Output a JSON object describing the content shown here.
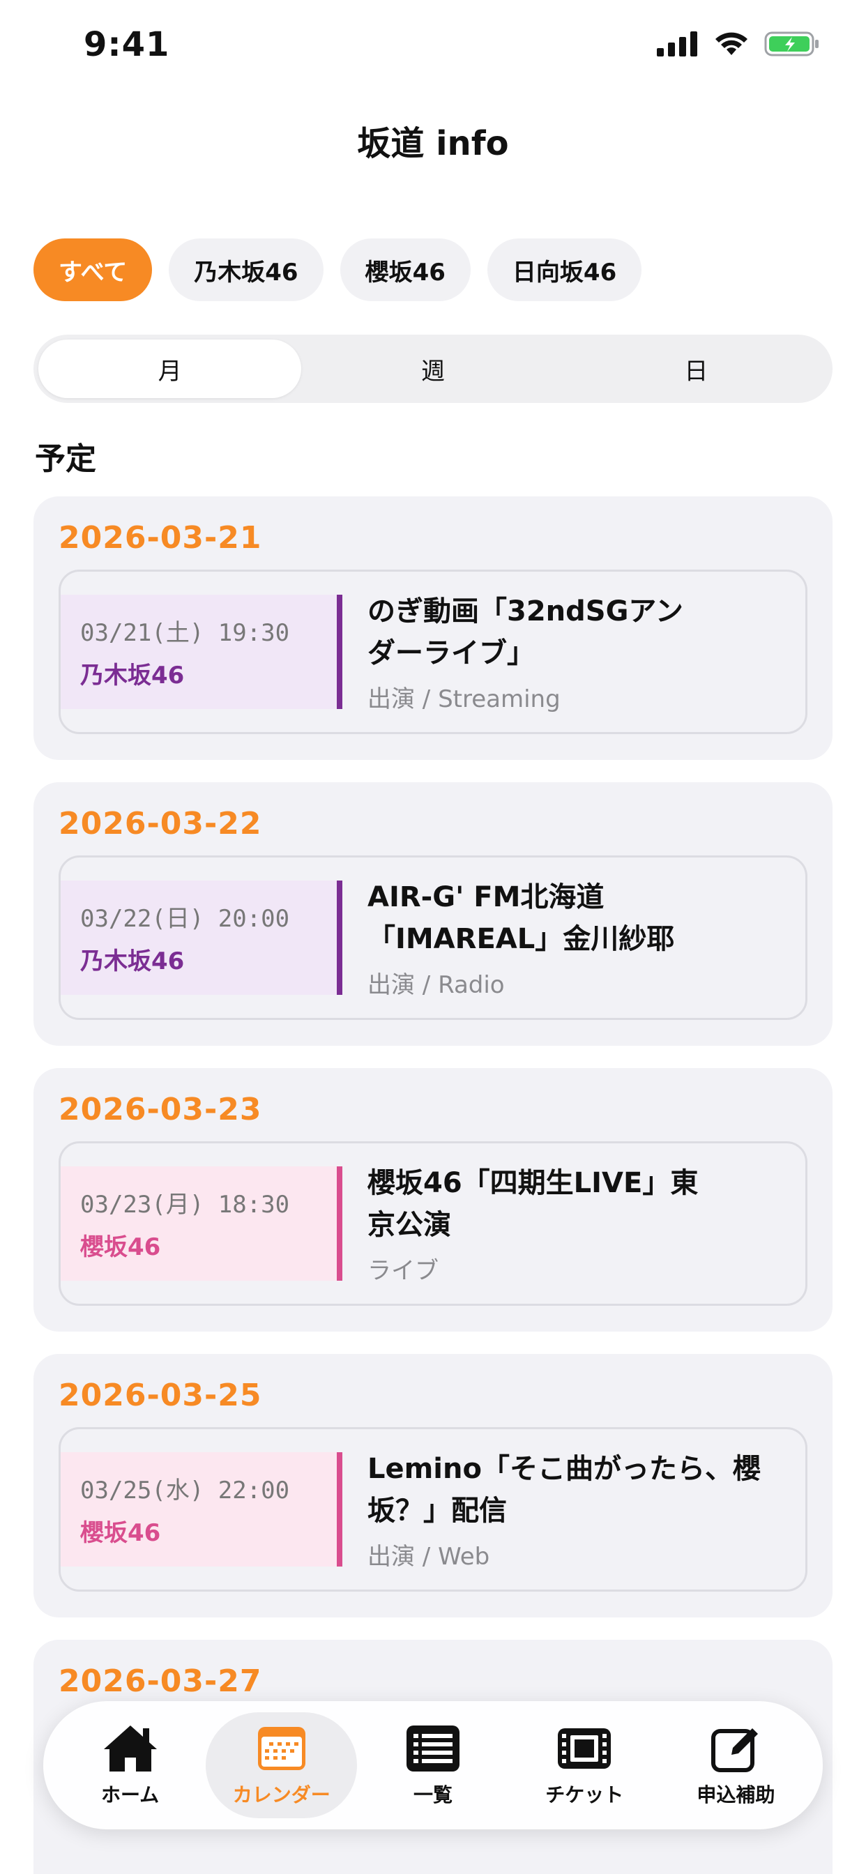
{
  "status": {
    "time": "9:41"
  },
  "title": "坂道 info",
  "filters": [
    {
      "label": "すべて",
      "active": true
    },
    {
      "label": "乃木坂46",
      "active": false
    },
    {
      "label": "櫻坂46",
      "active": false
    },
    {
      "label": "日向坂46",
      "active": false
    }
  ],
  "views": [
    {
      "label": "月",
      "active": true
    },
    {
      "label": "週",
      "active": false
    },
    {
      "label": "日",
      "active": false
    }
  ],
  "section": {
    "heading": "予定"
  },
  "days": [
    {
      "date": "2026-03-21",
      "event": {
        "time": "03/21(土) 19:30",
        "group": "乃木坂46",
        "title_line1": "のぎ動画「32ndSGアン",
        "title_line2": "ダーライブ」",
        "meta": "出演 / Streaming"
      }
    },
    {
      "date": "2026-03-22",
      "event": {
        "time": "03/22(日) 20:00",
        "group": "乃木坂46",
        "title_line1": "AIR-G' FM北海道",
        "title_line2": "「IMAREAL」金川紗耶",
        "meta": "出演 / Radio"
      }
    },
    {
      "date": "2026-03-23",
      "event": {
        "time": "03/23(月) 18:30",
        "group": "櫻坂46",
        "title_line1": "櫻坂46「四期生LIVE」東",
        "title_line2": "京公演",
        "meta": "ライブ"
      }
    },
    {
      "date": "2026-03-25",
      "event": {
        "time": "03/25(水) 22:00",
        "group": "櫻坂46",
        "title_line1": "Lemino「そこ曲がったら、櫻",
        "title_line2": "坂？」配信",
        "meta": "出演 / Web"
      }
    },
    {
      "date": "2026-03-27"
    }
  ],
  "tabs": [
    {
      "label": "ホーム",
      "icon": "house-icon",
      "active": false
    },
    {
      "label": "カレンダー",
      "icon": "calendar-icon",
      "active": true
    },
    {
      "label": "一覧",
      "icon": "list-icon",
      "active": false
    },
    {
      "label": "チケット",
      "icon": "ticket-film-icon",
      "active": false
    },
    {
      "label": "申込補助",
      "icon": "edit-icon",
      "active": false
    }
  ],
  "colors": {
    "accent": "#f78a24",
    "nogizaka": "#7b2d93",
    "sakurazaka": "#d94d8e"
  }
}
